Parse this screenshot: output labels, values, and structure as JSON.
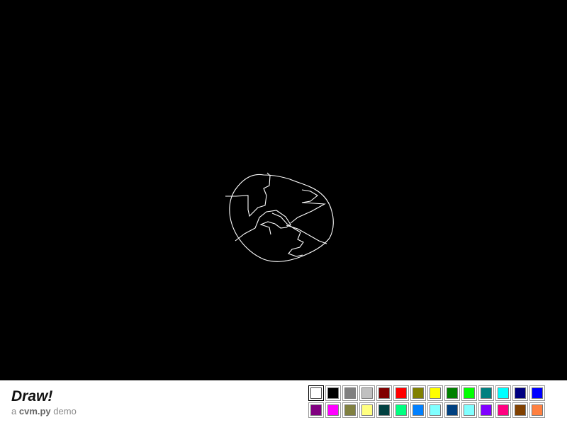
{
  "app": {
    "title": "Draw!",
    "subtitle_prefix": "a",
    "subtitle_brand": "cvm.py",
    "subtitle_suffix": "demo"
  },
  "canvas": {
    "background": "#000000",
    "stroke_color": "#ffffff"
  },
  "palette": {
    "selected_index": 0,
    "colors": [
      "#ffffff",
      "#000000",
      "#808080",
      "#c0c0c0",
      "#800000",
      "#ff0000",
      "#808000",
      "#ffff00",
      "#008000",
      "#00ff00",
      "#008080",
      "#00ffff",
      "#000080",
      "#0000ff",
      "#800080",
      "#ff00ff",
      "#808040",
      "#ffff80",
      "#004040",
      "#00ff80",
      "#0080ff",
      "#80ffff",
      "#004080",
      "#80ffff",
      "#8000ff",
      "#ff0080",
      "#804000",
      "#ff8040"
    ]
  }
}
